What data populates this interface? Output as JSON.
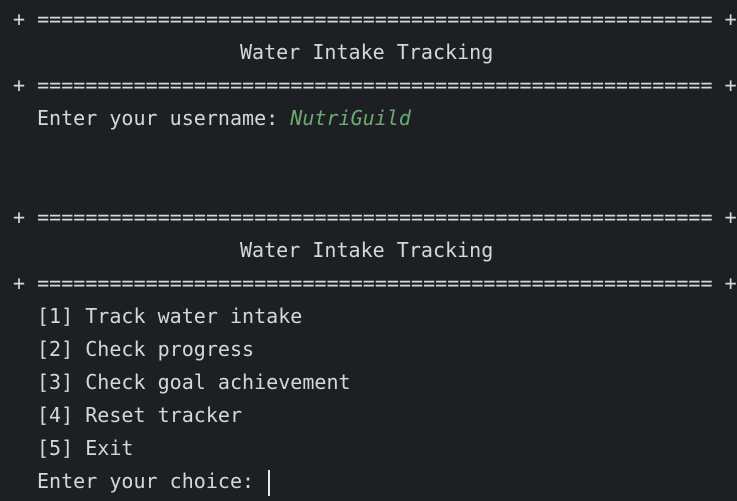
{
  "border_line": "+ ======================================================== +",
  "title": "Water Intake Tracking",
  "username_prompt": "Enter your username: ",
  "username_value": "NutriGuild",
  "menu_items": [
    "[1] Track water intake",
    "[2] Check progress",
    "[3] Check goal achievement",
    "[4] Reset tracker",
    "[5] Exit"
  ],
  "choice_prompt": "Enter your choice: "
}
